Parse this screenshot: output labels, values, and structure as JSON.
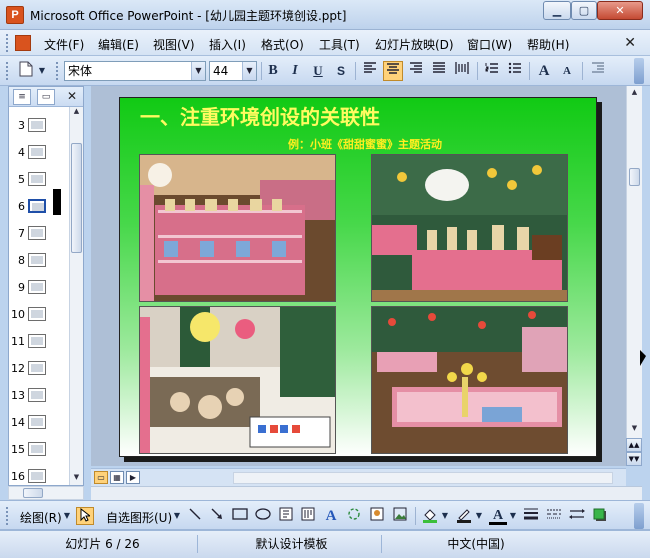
{
  "window": {
    "title": "Microsoft Office PowerPoint - [幼儿园主题环境创设.ppt]",
    "icon_label": "P",
    "min_label": "▁",
    "max_label": "▢",
    "close_label": "✕"
  },
  "menu": {
    "items": [
      "文件(F)",
      "编辑(E)",
      "视图(V)",
      "插入(I)",
      "格式(O)",
      "工具(T)",
      "幻灯片放映(D)",
      "窗口(W)",
      "帮助(H)"
    ],
    "close_label": "✕"
  },
  "toolbar": {
    "font_name": "宋体",
    "font_size": "44",
    "bold": "B",
    "italic": "I",
    "underline": "U",
    "shadow": "S",
    "increase_font": "A",
    "decrease_font": "A"
  },
  "outline_pane": {
    "close_label": "✕",
    "slides": [
      "3",
      "4",
      "5",
      "6",
      "7",
      "8",
      "9",
      "10",
      "11",
      "12",
      "13",
      "14",
      "15",
      "16"
    ],
    "selected": "6"
  },
  "slide": {
    "title": "一、注重环境创设的关联性",
    "subtitle": "例：小班《甜甜蜜蜜》主题活动"
  },
  "drawbar": {
    "draw_label": "绘图(R)",
    "autoshapes_label": "自选图形(U)"
  },
  "status": {
    "slide_position": "幻灯片 6 / 26",
    "design": "默认设计模板",
    "language": "中文(中国)"
  },
  "colors": {
    "title_yellow": "#fffb60",
    "slide_green": "#11ca14",
    "accent_orange": "#ffd27a"
  }
}
